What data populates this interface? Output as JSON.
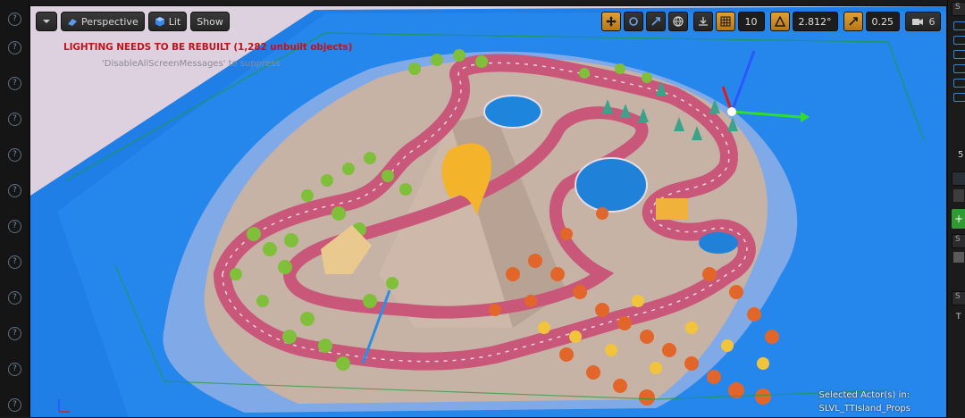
{
  "toolbar": {
    "dropdown_icon": "chevron-down-icon",
    "perspective_label": "Perspective",
    "lit_label": "Lit",
    "show_label": "Show"
  },
  "right_toolbar": {
    "grid_snap_value": "10",
    "rotation_snap_value": "2.812°",
    "scale_snap_value": "0.25",
    "camera_speed_value": "6"
  },
  "messages": {
    "lighting_warning": "LIGHTING NEEDS TO BE REBUILT (1,282 unbuilt objects)",
    "disable_hint": "'DisableAllScreenMessages' to suppress"
  },
  "selection": {
    "line1": "Selected Actor(s) in:",
    "line2": "SLVL_TTIsland_Props"
  },
  "right_panel": {
    "label_search": "S",
    "label_num": "5",
    "label_s2": "S",
    "label_s3": "S",
    "label_s4": "S",
    "label_t": "T"
  },
  "colors": {
    "warning_red": "#c0141c",
    "ocean_blue": "#1f7fe6",
    "road_pink": "#c9577a",
    "lava_yellow": "#f3b32a",
    "snap_active_orange": "#d8922a"
  }
}
